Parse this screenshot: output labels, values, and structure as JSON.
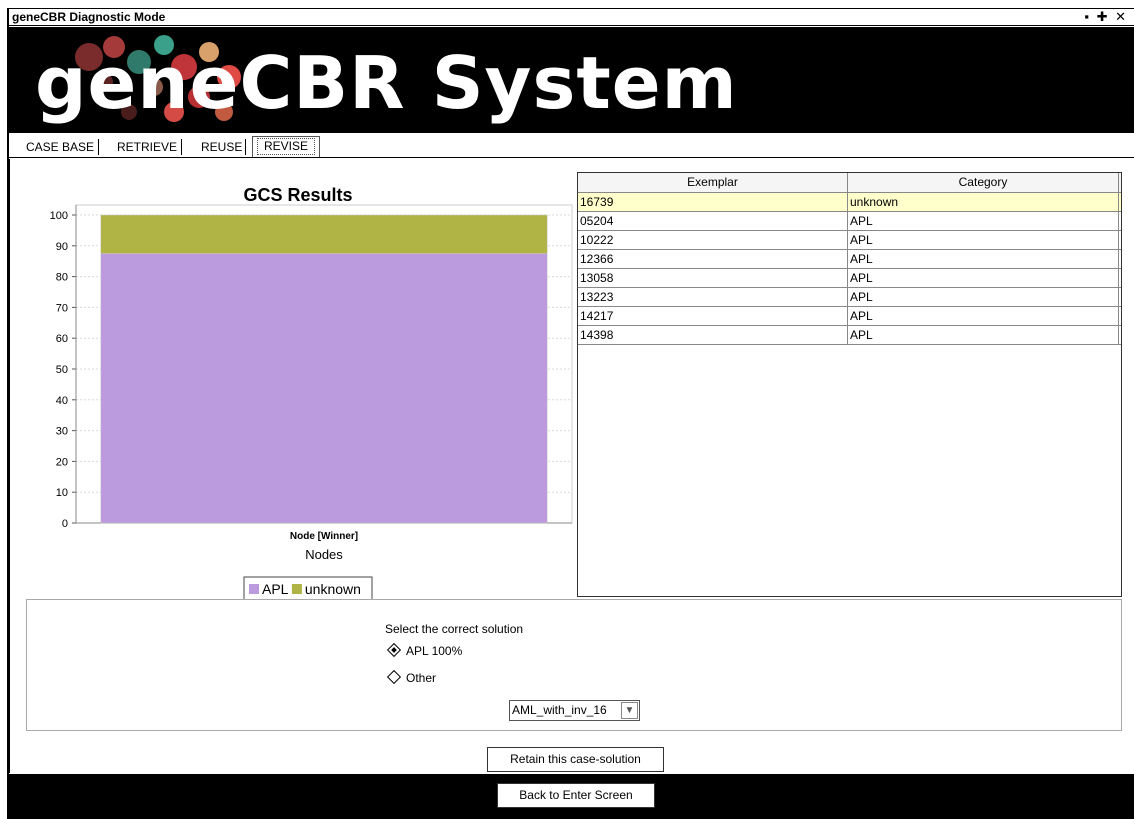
{
  "window": {
    "title": "geneCBR Diagnostic Mode",
    "controls": "▪ ✚ ✕"
  },
  "banner": {
    "logo_text": "geneCBR System"
  },
  "tabs": [
    {
      "label": "CASE BASE"
    },
    {
      "label": "RETRIEVE"
    },
    {
      "label": "REUSE"
    },
    {
      "label": "REVISE",
      "active": true
    }
  ],
  "chart_data": {
    "type": "bar",
    "title": "GCS Results",
    "categories": [
      "Node [Winner]"
    ],
    "series": [
      {
        "name": "APL",
        "values": [
          87.5
        ],
        "color": "#bb9bde"
      },
      {
        "name": "unknown",
        "values": [
          12.5
        ],
        "color": "#b0b444"
      }
    ],
    "stacked": true,
    "xlabel": "Nodes",
    "ylabel": "",
    "ylim": [
      0,
      100
    ],
    "yticks": [
      "0",
      "10",
      "20",
      "30",
      "40",
      "50",
      "60",
      "70",
      "80",
      "90",
      "100"
    ],
    "grid": true,
    "legend": "bottom"
  },
  "table": {
    "columns": [
      "Exemplar",
      "Category"
    ],
    "rows": [
      [
        "16739",
        "unknown"
      ],
      [
        "05204",
        "APL"
      ],
      [
        "10222",
        "APL"
      ],
      [
        "12366",
        "APL"
      ],
      [
        "13058",
        "APL"
      ],
      [
        "13223",
        "APL"
      ],
      [
        "14217",
        "APL"
      ],
      [
        "14398",
        "APL"
      ]
    ],
    "selected_row": 0
  },
  "solution": {
    "prompt": "Select the correct solution",
    "option_apl": "APL 100%",
    "option_other": "Other",
    "dropdown_value": "AML_with_inv_16"
  },
  "buttons": {
    "retain": "Retain this case-solution",
    "back": "Back to Enter Screen"
  }
}
